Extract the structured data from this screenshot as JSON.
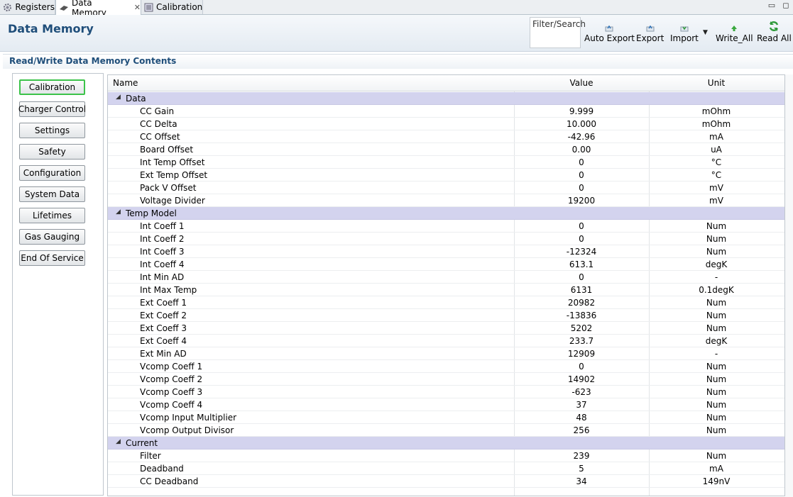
{
  "tabs": [
    {
      "label": "Registers",
      "icon": "gear-icon",
      "active": false
    },
    {
      "label": "Data Memory",
      "icon": "memory-chip-icon",
      "active": true,
      "close": "✕"
    },
    {
      "label": "Calibration",
      "icon": "calibration-icon",
      "active": false
    }
  ],
  "window_controls": {
    "minimize": "▭",
    "maximize": "◻"
  },
  "header": {
    "title": "Data Memory",
    "filter_label": "Filter/Search",
    "buttons": [
      {
        "label": "Auto Export",
        "icon": "auto-export-icon"
      },
      {
        "label": "Export",
        "icon": "export-icon"
      },
      {
        "label": "Import",
        "icon": "import-icon"
      },
      {
        "label": "Write_All",
        "icon": "green-up-arrow-icon"
      },
      {
        "label": "Read All",
        "icon": "green-refresh-icon"
      }
    ]
  },
  "section_title": "Read/Write Data Memory Contents",
  "nav": [
    {
      "label": "Calibration",
      "active": true
    },
    {
      "label": "Charger Control"
    },
    {
      "label": "Settings"
    },
    {
      "label": "Safety"
    },
    {
      "label": "Configuration"
    },
    {
      "label": "System Data"
    },
    {
      "label": "Lifetimes"
    },
    {
      "label": "Gas Gauging"
    },
    {
      "label": "End Of Service"
    }
  ],
  "table": {
    "columns": {
      "name": "Name",
      "value": "Value",
      "unit": "Unit"
    },
    "groups": [
      {
        "name": "Data",
        "rows": [
          {
            "name": "CC Gain",
            "value": "9.999",
            "unit": "mOhm"
          },
          {
            "name": "CC Delta",
            "value": "10.000",
            "unit": "mOhm"
          },
          {
            "name": "CC Offset",
            "value": "-42.96",
            "unit": "mA"
          },
          {
            "name": "Board Offset",
            "value": "0.00",
            "unit": "uA"
          },
          {
            "name": "Int Temp Offset",
            "value": "0",
            "unit": "°C"
          },
          {
            "name": "Ext Temp Offset",
            "value": "0",
            "unit": "°C"
          },
          {
            "name": "Pack V Offset",
            "value": "0",
            "unit": "mV"
          },
          {
            "name": "Voltage Divider",
            "value": "19200",
            "unit": "mV"
          }
        ]
      },
      {
        "name": "Temp Model",
        "rows": [
          {
            "name": "Int Coeff 1",
            "value": "0",
            "unit": "Num"
          },
          {
            "name": "Int Coeff 2",
            "value": "0",
            "unit": "Num"
          },
          {
            "name": "Int Coeff 3",
            "value": "-12324",
            "unit": "Num"
          },
          {
            "name": "Int Coeff 4",
            "value": "613.1",
            "unit": "degK"
          },
          {
            "name": "Int Min AD",
            "value": "0",
            "unit": "-"
          },
          {
            "name": "Int Max Temp",
            "value": "6131",
            "unit": "0.1degK"
          },
          {
            "name": "Ext Coeff 1",
            "value": "20982",
            "unit": "Num"
          },
          {
            "name": "Ext Coeff 2",
            "value": "-13836",
            "unit": "Num"
          },
          {
            "name": "Ext Coeff 3",
            "value": "5202",
            "unit": "Num"
          },
          {
            "name": "Ext Coeff 4",
            "value": "233.7",
            "unit": "degK"
          },
          {
            "name": "Ext Min AD",
            "value": "12909",
            "unit": "-"
          },
          {
            "name": "Vcomp Coeff 1",
            "value": "0",
            "unit": "Num"
          },
          {
            "name": "Vcomp Coeff 2",
            "value": "14902",
            "unit": "Num"
          },
          {
            "name": "Vcomp Coeff 3",
            "value": "-623",
            "unit": "Num"
          },
          {
            "name": "Vcomp Coeff 4",
            "value": "37",
            "unit": "Num"
          },
          {
            "name": "Vcomp Input Multiplier",
            "value": "48",
            "unit": "Num"
          },
          {
            "name": "Vcomp Output Divisor",
            "value": "256",
            "unit": "Num"
          }
        ]
      },
      {
        "name": "Current",
        "rows": [
          {
            "name": "Filter",
            "value": "239",
            "unit": "Num"
          },
          {
            "name": "Deadband",
            "value": "5",
            "unit": "mA"
          },
          {
            "name": "CC Deadband",
            "value": "34",
            "unit": "149nV"
          }
        ]
      }
    ]
  },
  "colors": {
    "accent_title": "#1f4e7a",
    "group_row": "#d3d3ee",
    "active_nav_border": "#3cc34a"
  }
}
